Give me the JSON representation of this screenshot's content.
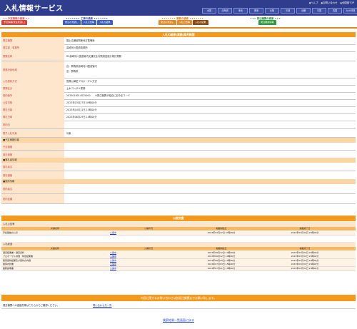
{
  "app": {
    "title": "入札情報サービス"
  },
  "toplinks": [
    "◆ヘルプ",
    "◆お問い合わせ",
    "◆全国案TOP"
  ],
  "regions": [
    "全国",
    "北海道",
    "東北",
    "関東",
    "北陸",
    "中部",
    "近畿",
    "中国",
    "四国",
    "九州沖縄"
  ],
  "nav": {
    "groups": [
      {
        "title": "✦✦ 予定情報の検索 ✦✦",
        "color": "#d9534f",
        "tabs": [
          {
            "label": "予定情報(発注見通し)",
            "color": "#d8453a"
          }
        ]
      },
      {
        "title": "✦✦✦✦✦✦✦ 工事の検索 ✦✦✦✦✦✦✦",
        "color": "#3b4aa5",
        "tabs": [
          {
            "label": "発注の見通し",
            "color": "#3b5fbf"
          },
          {
            "label": "入札公告等",
            "color": "#3b5fbf"
          },
          {
            "label": "入札の結果",
            "color": "#3b5fbf"
          }
        ]
      },
      {
        "title": "✦✦✦✦✦✦✦ 業務の検索 ✦✦✦✦✦✦✦",
        "color": "#e07a10",
        "tabs": [
          {
            "label": "発注の見通し",
            "color": "#e38a2a"
          },
          {
            "label": "入札公告等",
            "color": "#e38a2a"
          },
          {
            "label": "入札の結果",
            "color": "#8a4a10"
          }
        ]
      },
      {
        "title": "✦✦✦ 発注機関の検索 ✦✦✦",
        "color": "#2a8a3a",
        "tabs": [
          {
            "label": "発注機関情報",
            "color": "#2f9a3e"
          }
        ]
      }
    ]
  },
  "detail": {
    "title": "入札の結果(業務)案件概要",
    "rows": [
      {
        "label": "発注機関",
        "value": "国土交通省関東地方整備局"
      },
      {
        "label": "発注部・事務所",
        "value": "高崎河川国道事務所"
      },
      {
        "label": "業務名称",
        "value": "R5高崎河川国道管内交通安全対策調査設計検討業務"
      },
      {
        "label": "業務対象地域",
        "value": "自：群馬県高崎河川国道管内\n至：群馬県"
      },
      {
        "label": "入札契約方式",
        "value": "簡易公募型プロポーザル方式"
      },
      {
        "label": "業務区分",
        "value": "土木コンサル業務"
      },
      {
        "label": "契約番号",
        "value": "2023016014025000　　※発注機関が独自に定めるコード"
      },
      {
        "label": "公告日時",
        "value": "2023年03月27日 09時00分"
      },
      {
        "label": "開札日時",
        "value": "2023年04月11日 15時00分"
      },
      {
        "label": "開札日時",
        "value": "2023年06月29日 10時00分"
      },
      {
        "label": "契約日",
        "value": ""
      },
      {
        "label": "電子入札対象",
        "value": "対象"
      }
    ],
    "yotei_head": "■予定価格情報",
    "yotei_rows": [
      {
        "label": "予定価格",
        "value": ""
      },
      {
        "label": "落札価格",
        "value": ""
      }
    ],
    "rakusatsu_head": "■落札者情報",
    "rakusatsu_rows": [
      {
        "label": "落札者名",
        "value": ""
      },
      {
        "label": "落札価格",
        "value": ""
      }
    ],
    "keiyaku_head": "■契約情報",
    "keiyaku_rows": [
      {
        "label": "契約者名",
        "value": ""
      },
      {
        "label": "契約金額",
        "value": ""
      }
    ]
  },
  "docs": {
    "title": "公開文書",
    "koukoku": {
      "head": "入札公告等",
      "columns": [
        "文書名称",
        "公開状況",
        "掲載開始日",
        "掲載終了日"
      ],
      "rows": [
        {
          "name": "手続開始の公示",
          "status": "公開中",
          "start": "2023年03月27日 07時00分",
          "end": "2024年03月31日 23時00分"
        }
      ]
    },
    "kekka": {
      "head": "入札経過",
      "columns": [
        "文書名称",
        "公開状況",
        "掲載開始日",
        "掲載終了日"
      ],
      "rows": [
        {
          "name": "選定結果書・選定資料",
          "status": "公開中",
          "start": "2023年06月12日 10時00分",
          "end": "2023年03月31日 23時00分"
        },
        {
          "name": "プロポーザル評価・特定結果書",
          "status": "公開中",
          "start": "2023年06月12日 10時00分",
          "end": "2023年03月31日 23時00分"
        },
        {
          "name": "随意契約結果及び契約の内容",
          "status": "公開中",
          "start": "2023年06月29日 10時00分",
          "end": "2023年03月31日 23時00分"
        },
        {
          "name": "積算内訳書",
          "status": "公開中",
          "start": "2023年07月03日 15時00分",
          "end": "2023年03月31日 23時00分"
        },
        {
          "name": "業務説明書",
          "status": "公開中",
          "start": "2023年07月21日 15時00分",
          "end": "2023年03月31日 23時00分"
        }
      ]
    }
  },
  "contact": {
    "bar": "内容に関するお問い合わせは各発注機関までお願い致します。",
    "label": "発注機関への連絡先等はこちらからご確認ください。",
    "link": "問い合わせ先一覧"
  },
  "back_link": "検索結果一覧画面に戻る"
}
